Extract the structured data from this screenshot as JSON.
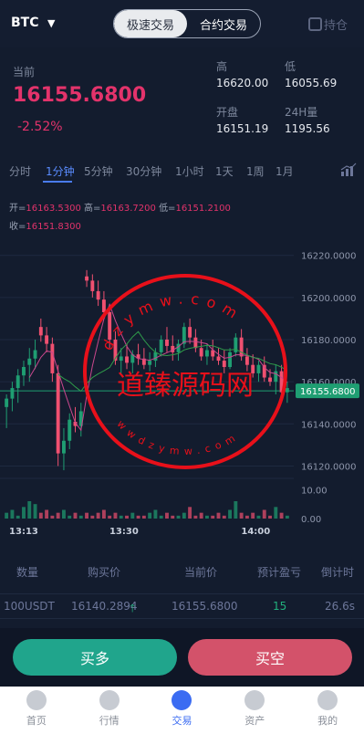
{
  "header": {
    "symbol": "BTC",
    "tabs": [
      "极速交易",
      "合约交易"
    ],
    "holding_label": "持仓"
  },
  "ticker": {
    "now_label": "当前",
    "price": "16155.6800",
    "change": "-2.52%",
    "high_label": "高",
    "high": "16620.00",
    "low_label": "低",
    "low": "16055.69",
    "open_label": "开盘",
    "open": "16151.19",
    "vol_label": "24H量",
    "vol": "1195.56"
  },
  "timeframes": [
    "分时",
    "1分钟",
    "5分钟",
    "30分钟",
    "1小时",
    "1天",
    "1周",
    "1月"
  ],
  "ohlc": {
    "open_label": "开=",
    "open": "16163.5300",
    "high_label": "高=",
    "high": "16163.7200",
    "low_label": "低=",
    "low": "16151.2100",
    "close_label": "收=",
    "close": "16151.8300"
  },
  "chart_data": {
    "type": "candlestick",
    "yticks": [
      "16220.0000",
      "16200.0000",
      "16180.0000",
      "16160.0000",
      "16140.0000",
      "16120.0000"
    ],
    "current_price": "16155.6800",
    "xticks": [
      "13:13",
      "13:30",
      "14:00"
    ],
    "volume_ticks": [
      "10.00",
      "0.00"
    ],
    "ylim": [
      16115,
      16232
    ],
    "volume_ylim": [
      0,
      12
    ],
    "candles": [
      [
        16148,
        16154,
        16138,
        16152
      ],
      [
        16152,
        16160,
        16146,
        16157
      ],
      [
        16157,
        16166,
        16150,
        16163
      ],
      [
        16163,
        16170,
        16158,
        16167
      ],
      [
        16168,
        16176,
        16160,
        16171
      ],
      [
        16171,
        16180,
        16166,
        16175
      ],
      [
        16186,
        16190,
        16179,
        16182
      ],
      [
        16182,
        16186,
        16174,
        16178
      ],
      [
        16178,
        16181,
        16160,
        16164
      ],
      [
        16164,
        16168,
        16120,
        16126
      ],
      [
        16126,
        16138,
        16118,
        16132
      ],
      [
        16132,
        16145,
        16128,
        16142
      ],
      [
        16141,
        16148,
        16136,
        16139
      ],
      [
        16139,
        16150,
        16134,
        16146
      ],
      [
        16210,
        16213,
        16205,
        16208
      ],
      [
        16208,
        16211,
        16200,
        16203
      ],
      [
        16203,
        16208,
        16196,
        16199
      ],
      [
        16199,
        16203,
        16190,
        16193
      ],
      [
        16193,
        16197,
        16176,
        16180
      ],
      [
        16180,
        16184,
        16168,
        16170
      ],
      [
        16170,
        16176,
        16164,
        16172
      ],
      [
        16172,
        16178,
        16166,
        16169
      ],
      [
        16169,
        16175,
        16164,
        16173
      ],
      [
        16173,
        16178,
        16168,
        16171
      ],
      [
        16171,
        16176,
        16166,
        16168
      ],
      [
        16168,
        16174,
        16165,
        16170
      ],
      [
        16170,
        16176,
        16167,
        16174
      ],
      [
        16174,
        16182,
        16172,
        16180
      ],
      [
        16180,
        16186,
        16174,
        16177
      ],
      [
        16177,
        16182,
        16170,
        16174
      ],
      [
        16174,
        16180,
        16170,
        16178
      ],
      [
        16178,
        16188,
        16176,
        16186
      ],
      [
        16186,
        16190,
        16178,
        16181
      ],
      [
        16181,
        16185,
        16174,
        16176
      ],
      [
        16176,
        16180,
        16170,
        16172
      ],
      [
        16172,
        16178,
        16168,
        16175
      ],
      [
        16175,
        16180,
        16170,
        16172
      ],
      [
        16172,
        16176,
        16168,
        16170
      ],
      [
        16170,
        16175,
        16164,
        16167
      ],
      [
        16167,
        16176,
        16166,
        16174
      ],
      [
        16174,
        16183,
        16172,
        16181
      ],
      [
        16181,
        16185,
        16170,
        16172
      ],
      [
        16172,
        16176,
        16165,
        16168
      ],
      [
        16168,
        16173,
        16162,
        16164
      ],
      [
        16164,
        16170,
        16160,
        16168
      ],
      [
        16168,
        16172,
        16160,
        16162
      ],
      [
        16162,
        16166,
        16158,
        16160
      ],
      [
        16160,
        16168,
        16154,
        16165
      ],
      [
        16165,
        16168,
        16152,
        16155
      ],
      [
        16155,
        16160,
        16150,
        16157
      ]
    ],
    "volumes": [
      2,
      3,
      1,
      4,
      6,
      5,
      2,
      3,
      1,
      2,
      3,
      1,
      2,
      1,
      2,
      1,
      2,
      3,
      1,
      2,
      1,
      1,
      2,
      1,
      1,
      2,
      3,
      1,
      2,
      1,
      1,
      2,
      4,
      1,
      2,
      1,
      1,
      2,
      1,
      3,
      6,
      2,
      1,
      2,
      1,
      3,
      1,
      4,
      2,
      1
    ],
    "colors": {
      "up": "#1f9e72",
      "down": "#f05070",
      "stamp": "#e8101a"
    }
  },
  "stamp": {
    "top_text": "dzymw.com",
    "center_text": "道臻源码网",
    "bottom_text": "wwdzymw.com"
  },
  "orders": {
    "headers": [
      "数量",
      "购买价",
      "当前价",
      "预计盈亏",
      "倒计时"
    ],
    "row": {
      "amount": "100USDT",
      "buy_price": "16140.2894",
      "current": "16155.6800",
      "profit": "15",
      "countdown": "26.6s"
    }
  },
  "actions": {
    "buy": "买多",
    "sell": "买空"
  },
  "nav": [
    "首页",
    "行情",
    "交易",
    "资产",
    "我的"
  ]
}
